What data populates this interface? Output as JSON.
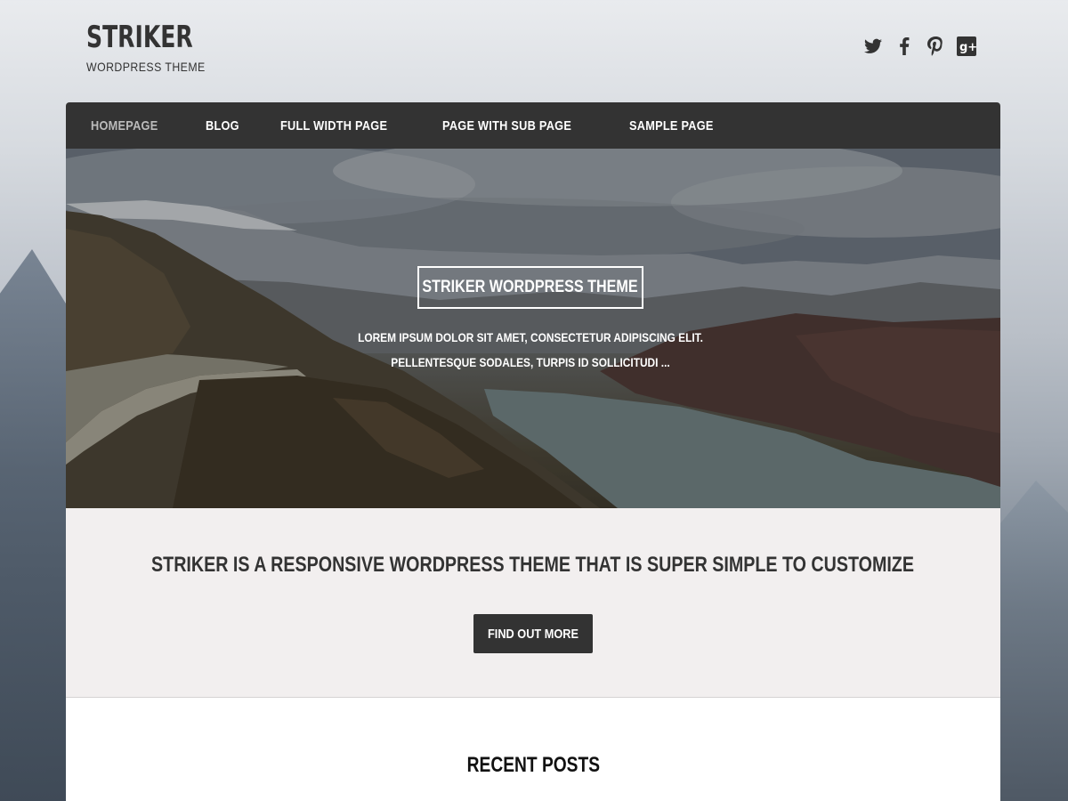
{
  "header": {
    "site_title": "STRIKER",
    "tagline": "WORDPRESS THEME",
    "social": [
      "twitter-icon",
      "facebook-icon",
      "pinterest-icon",
      "google-plus-icon"
    ]
  },
  "nav": {
    "items": [
      {
        "label": "HOMEPAGE",
        "active": true
      },
      {
        "label": "BLOG"
      },
      {
        "label": "FULL WIDTH PAGE"
      },
      {
        "label": "PAGE WITH SUB PAGE"
      },
      {
        "label": "SAMPLE PAGE"
      }
    ]
  },
  "hero": {
    "title": "STRIKER WORDPRESS THEME",
    "text": "LOREM IPSUM DOLOR SIT AMET, CONSECTETUR ADIPISCING ELIT. PELLENTESQUE SODALES, TURPIS ID SOLLICITUDI ..."
  },
  "promo": {
    "heading": "STRIKER IS A RESPONSIVE WORDPRESS THEME THAT IS SUPER SIMPLE TO CUSTOMIZE",
    "button_label": "FIND OUT MORE"
  },
  "posts": {
    "heading": "RECENT POSTS"
  },
  "colors": {
    "nav_bg": "#333333",
    "promo_bg": "#f2efef",
    "button_bg": "#333333",
    "text_dark": "#333333"
  }
}
